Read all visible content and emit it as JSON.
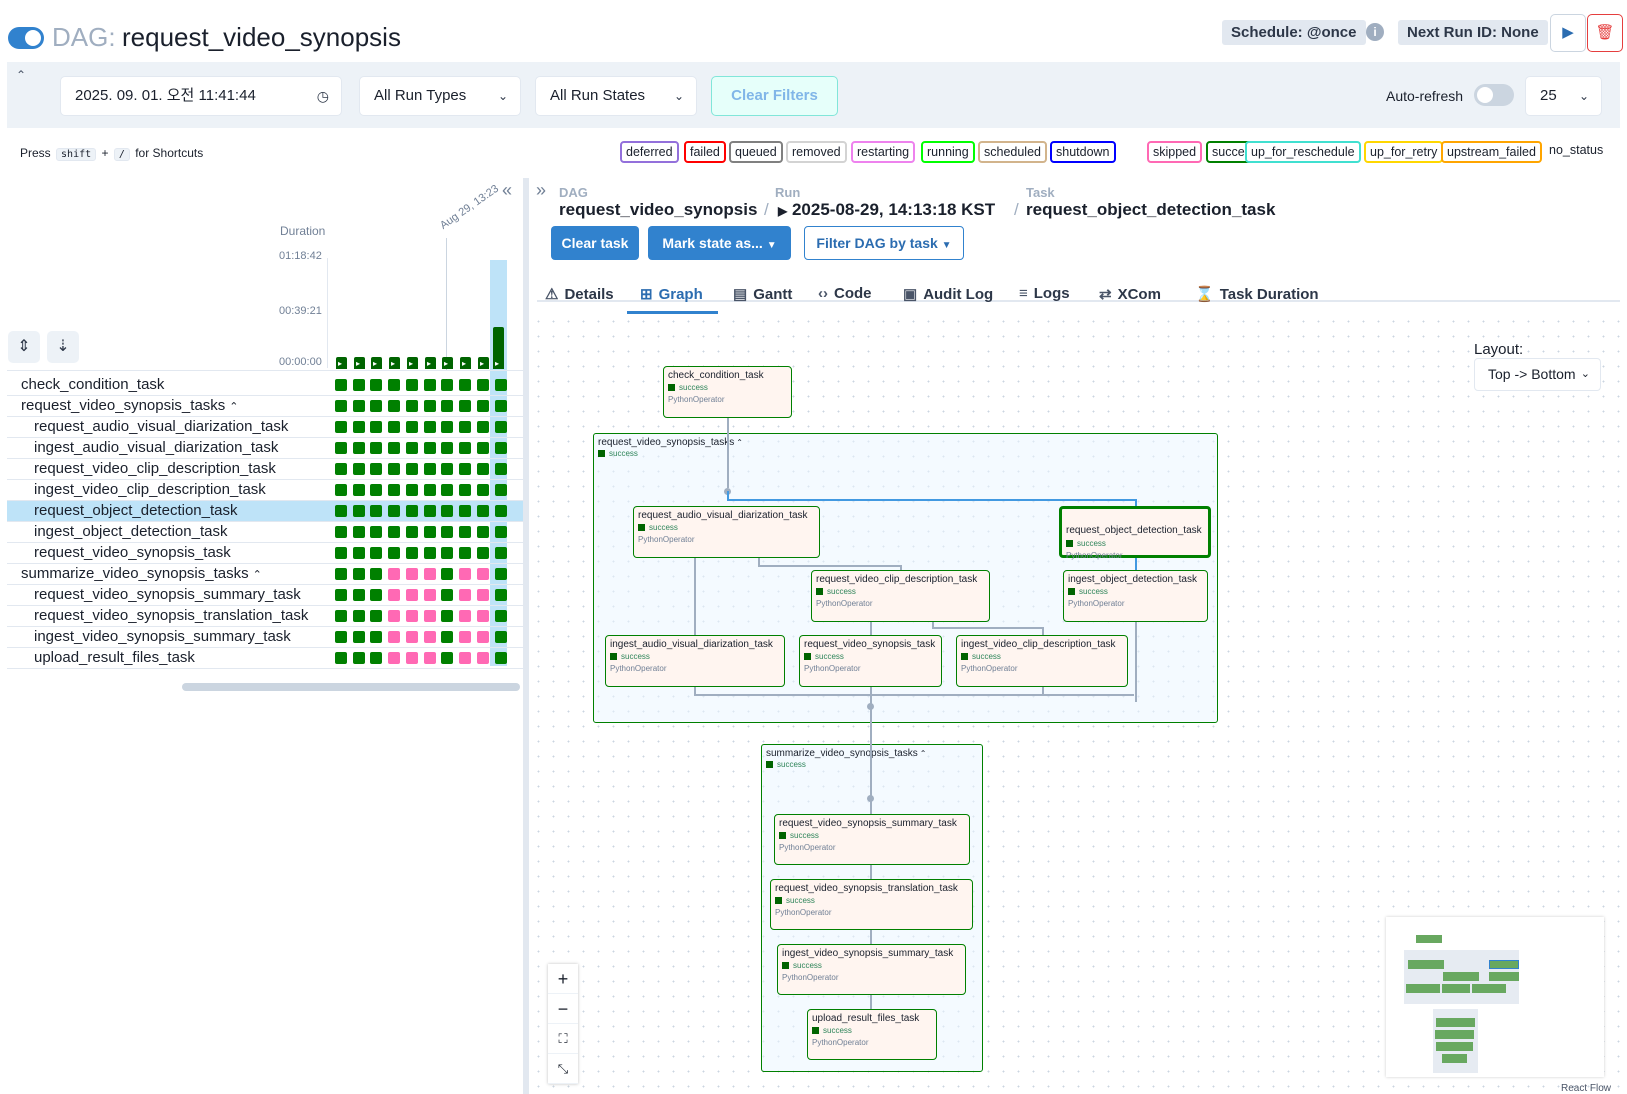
{
  "header": {
    "dag_prefix": "DAG:",
    "dag_name": "request_video_synopsis",
    "schedule": "Schedule: @once",
    "next_run": "Next Run ID: None"
  },
  "filters": {
    "datetime": "2025. 09. 01.   오전 11:41:44",
    "run_types": "All Run Types",
    "run_states": "All Run States",
    "clear_label": "Clear Filters",
    "auto_refresh_label": "Auto-refresh",
    "page_size": "25"
  },
  "shortcuts": {
    "press": "Press",
    "key1": "shift",
    "plus": "+",
    "key2": "/",
    "suffix": "for Shortcuts"
  },
  "legend": [
    {
      "label": "deferred",
      "color": "#9370db"
    },
    {
      "label": "failed",
      "color": "#ff0000"
    },
    {
      "label": "queued",
      "color": "#808080"
    },
    {
      "label": "removed",
      "color": "#d3d3d3"
    },
    {
      "label": "restarting",
      "color": "#ee82ee"
    },
    {
      "label": "running",
      "color": "#00ff00"
    },
    {
      "label": "scheduled",
      "color": "#d2b48c"
    },
    {
      "label": "shutdown",
      "color": "#0000ff"
    },
    {
      "label": "skipped",
      "color": "#ff69b4"
    },
    {
      "label": "success",
      "color": "#008000"
    },
    {
      "label": "up_for_reschedule",
      "color": "#40e0d0"
    },
    {
      "label": "up_for_retry",
      "color": "#ffd700"
    },
    {
      "label": "upstream_failed",
      "color": "#ffa500"
    },
    {
      "label": "no_status",
      "color": "#ffffff"
    }
  ],
  "grid": {
    "duration_label": "Duration",
    "ticks": [
      "01:18:42",
      "00:39:21",
      "00:00:00"
    ],
    "date_label": "Aug 29, 13:23",
    "run_durations": [
      0.04,
      0.04,
      0.04,
      0.04,
      0.04,
      0.04,
      0.08,
      0.04,
      0.08,
      0.38
    ],
    "tasks": [
      {
        "name": "check_condition_task",
        "indent": 0,
        "states": "SSSSSSSSSS"
      },
      {
        "name": "request_video_synopsis_tasks",
        "indent": 0,
        "group": true,
        "states": "SSSSSSSSSS"
      },
      {
        "name": "request_audio_visual_diarization_task",
        "indent": 1,
        "states": "SSSSSSSSSS"
      },
      {
        "name": "ingest_audio_visual_diarization_task",
        "indent": 1,
        "states": "SSSSSSSSSS"
      },
      {
        "name": "request_video_clip_description_task",
        "indent": 1,
        "states": "SSSSSSSSSS"
      },
      {
        "name": "ingest_video_clip_description_task",
        "indent": 1,
        "states": "SSSSSSSSSS"
      },
      {
        "name": "request_object_detection_task",
        "indent": 1,
        "selected": true,
        "states": "SSSSSSSSSS"
      },
      {
        "name": "ingest_object_detection_task",
        "indent": 1,
        "states": "SSSSSSSSSS"
      },
      {
        "name": "request_video_synopsis_task",
        "indent": 1,
        "states": "SSSSSSSSSS"
      },
      {
        "name": "summarize_video_synopsis_tasks",
        "indent": 0,
        "group": true,
        "states": "SSSKKKSKKS"
      },
      {
        "name": "request_video_synopsis_summary_task",
        "indent": 1,
        "states": "SSSKKKSKKS"
      },
      {
        "name": "request_video_synopsis_translation_task",
        "indent": 1,
        "states": "SSSKKKSKKS"
      },
      {
        "name": "ingest_video_synopsis_summary_task",
        "indent": 1,
        "states": "SSSKKKSKKS"
      },
      {
        "name": "upload_result_files_task",
        "indent": 1,
        "states": "SSSKKKSKKS"
      }
    ]
  },
  "breadcrumb": {
    "dag_label": "DAG",
    "dag_value": "request_video_synopsis",
    "run_label": "Run",
    "run_value": "2025-08-29, 14:13:18 KST",
    "task_label": "Task",
    "task_value": "request_object_detection_task"
  },
  "actions": {
    "clear_task": "Clear task",
    "mark_state": "Mark state as...",
    "filter_dag": "Filter DAG by task"
  },
  "tabs": [
    "Details",
    "Graph",
    "Gantt",
    "Code",
    "Audit Log",
    "Logs",
    "XCom",
    "Task Duration"
  ],
  "graph": {
    "layout_label": "Layout:",
    "layout_value": "Top -> Bottom",
    "react_flow": "React Flow",
    "status": "success",
    "operator": "PythonOperator",
    "groups": {
      "g1": "request_video_synopsis_tasks",
      "g2": "summarize_video_synopsis_tasks"
    },
    "nodes": {
      "n_check": "check_condition_task",
      "n_rav": "request_audio_visual_diarization_task",
      "n_rod": "request_object_detection_task",
      "n_rvc": "request_video_clip_description_task",
      "n_iod": "ingest_object_detection_task",
      "n_iav": "ingest_audio_visual_diarization_task",
      "n_rvs": "request_video_synopsis_task",
      "n_ivc": "ingest_video_clip_description_task",
      "n_sum": "request_video_synopsis_summary_task",
      "n_tr": "request_video_synopsis_translation_task",
      "n_isum": "ingest_video_synopsis_summary_task",
      "n_up": "upload_result_files_task"
    }
  }
}
